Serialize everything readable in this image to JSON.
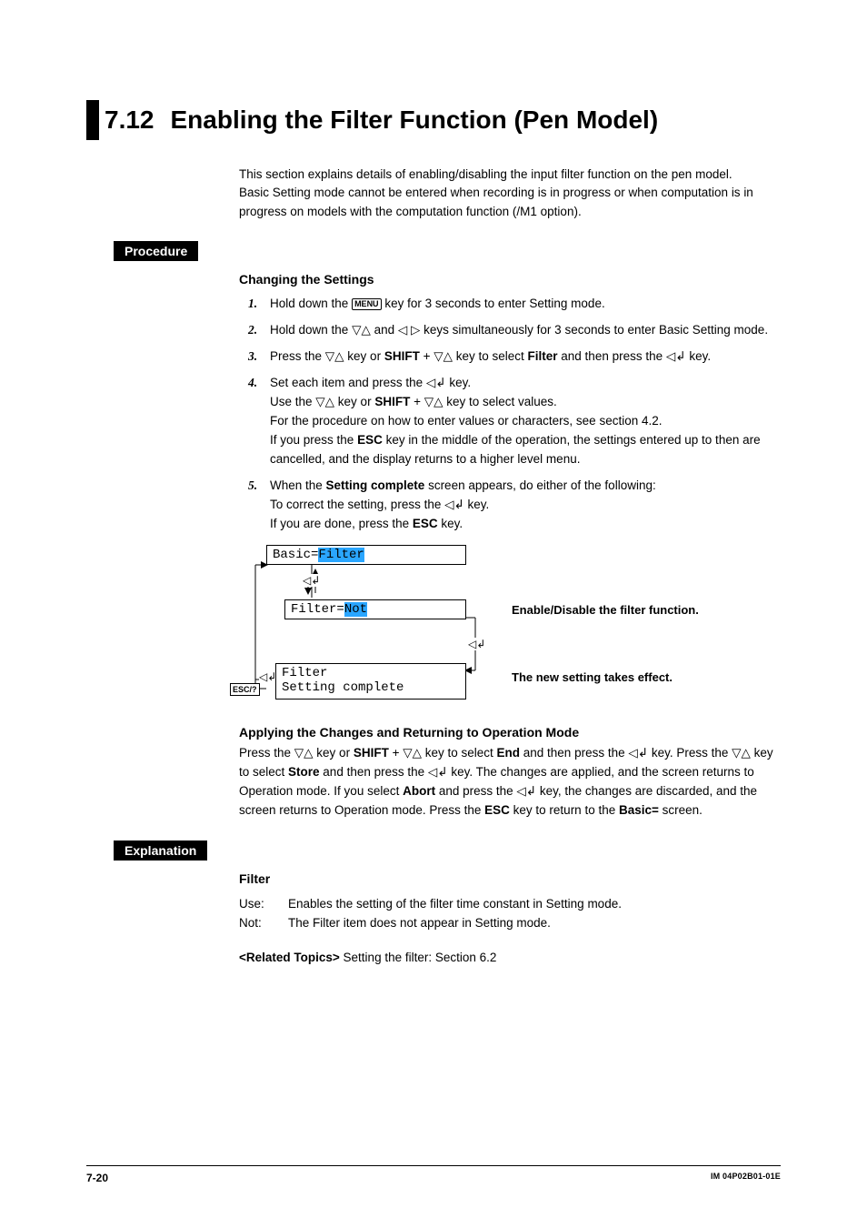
{
  "title_num": "7.12",
  "title_text": "Enabling the Filter Function (Pen Model)",
  "intro_lines": [
    "This section explains details of enabling/disabling the input filter function on the pen model.",
    "Basic Setting mode cannot be entered when recording is in progress or when computation is in progress on models with the computation function (/M1 option)."
  ],
  "procedure_label": "Procedure",
  "changing_h": "Changing the Settings",
  "menu_key": "MENU",
  "shift": "SHIFT",
  "esc": "ESC",
  "filter_word": "Filter",
  "setting_complete": "Setting complete",
  "end_word": "End",
  "store_word": "Store",
  "abort_word": "Abort",
  "basic_eq": "Basic=",
  "steps": {
    "s1a": "Hold down the ",
    "s1b": " key for 3 seconds to enter Setting mode.",
    "s2a": "Hold down the ",
    "s2b": " and ",
    "s2c": " keys simultaneously for 3 seconds to enter Basic Setting mode.",
    "s3a": "Press the ",
    "s3b": " key or ",
    "s3c": " + ",
    "s3d": " key to select ",
    "s3e": " and then press the ",
    "s3f": " key.",
    "s4a": "Set each item and press the ",
    "s4b": " key.",
    "s4c": "Use the ",
    "s4d": " key or ",
    "s4e": " + ",
    "s4f": " key to select values.",
    "s4g": "For the procedure on how to enter values or characters, see section 4.2.",
    "s4h1": "If you press the ",
    "s4h2": " key in the middle of the operation, the settings entered up to then are cancelled, and the display returns to a higher level menu.",
    "s5a": "When the ",
    "s5b": " screen appears, do either of the following:",
    "s5c": "To correct the setting, press the ",
    "s5d": " key.",
    "s5e": "If you are done, press the ",
    "s5f": " key."
  },
  "diagram": {
    "esc_label": "ESC/?",
    "lcd1_pre": "Basic=",
    "lcd1_hl": "Filter",
    "lcd2_pre": "Filter=",
    "lcd2_hl": "Not",
    "lcd3_l1": "Filter",
    "lcd3_l2": "Setting complete",
    "ann1": "Enable/Disable the filter function.",
    "ann2": "The new setting takes effect."
  },
  "apply_h": "Applying the Changes and Returning to Operation Mode",
  "apply_parts": {
    "p1": "Press the ",
    "p2": " key or ",
    "p3": " + ",
    "p4": " key to select ",
    "p5": " and then press the ",
    "p6": " key. Press the ",
    "p7": " key to select ",
    "p8": " and then press the ",
    "p9": " key. The changes are applied, and the screen returns to Operation mode. If you select ",
    "p10": " and press the ",
    "p11": " key, the changes are discarded, and the screen returns to Operation mode. Press the ",
    "p12": " key to return to the ",
    "p13": " screen."
  },
  "explanation_label": "Explanation",
  "filter_h": "Filter",
  "filter_rows": [
    {
      "k": "Use:",
      "v": "Enables the setting of the filter time constant in Setting mode."
    },
    {
      "k": "Not:",
      "v": "The Filter item does not appear in Setting mode."
    }
  ],
  "related_label": "<Related Topics>",
  "related_text": "  Setting the filter: Section 6.2",
  "footer_page": "7-20",
  "footer_doc": "IM 04P02B01-01E"
}
